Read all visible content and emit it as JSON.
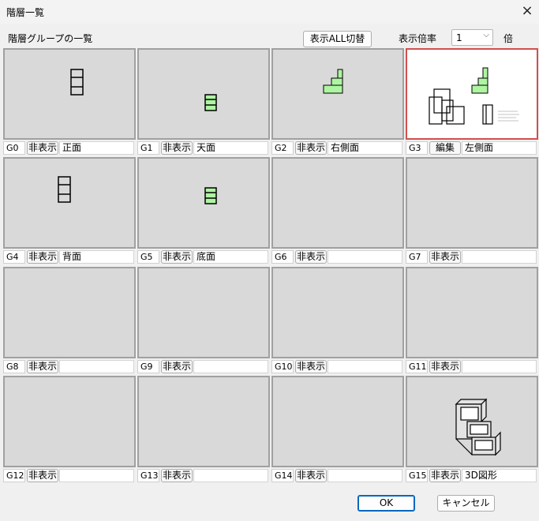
{
  "window": {
    "title": "階層一覧",
    "close_icon": "×"
  },
  "header": {
    "label": "階層グループの一覧",
    "toggle_all_button": "表示ALL切替",
    "zoom_label": "表示倍率",
    "zoom_value": "1",
    "zoom_unit": "倍"
  },
  "groups": [
    {
      "id": "G0",
      "button": "非表示",
      "name": "正面"
    },
    {
      "id": "G1",
      "button": "非表示",
      "name": "天面"
    },
    {
      "id": "G2",
      "button": "非表示",
      "name": "右側面"
    },
    {
      "id": "G3",
      "button": "編集",
      "name": "左側面"
    },
    {
      "id": "G4",
      "button": "非表示",
      "name": "背面"
    },
    {
      "id": "G5",
      "button": "非表示",
      "name": "底面"
    },
    {
      "id": "G6",
      "button": "非表示",
      "name": ""
    },
    {
      "id": "G7",
      "button": "非表示",
      "name": ""
    },
    {
      "id": "G8",
      "button": "非表示",
      "name": ""
    },
    {
      "id": "G9",
      "button": "非表示",
      "name": ""
    },
    {
      "id": "G10",
      "button": "非表示",
      "name": ""
    },
    {
      "id": "G11",
      "button": "非表示",
      "name": ""
    },
    {
      "id": "G12",
      "button": "非表示",
      "name": ""
    },
    {
      "id": "G13",
      "button": "非表示",
      "name": ""
    },
    {
      "id": "G14",
      "button": "非表示",
      "name": ""
    },
    {
      "id": "G15",
      "button": "非表示",
      "name": "3D図形"
    }
  ],
  "selected_group": "G3",
  "footer": {
    "ok": "OK",
    "cancel": "キャンセル"
  },
  "colors": {
    "thumb_fill": "#aef5a2",
    "selected_border": "#d0504f",
    "ok_border": "#0067c0"
  }
}
